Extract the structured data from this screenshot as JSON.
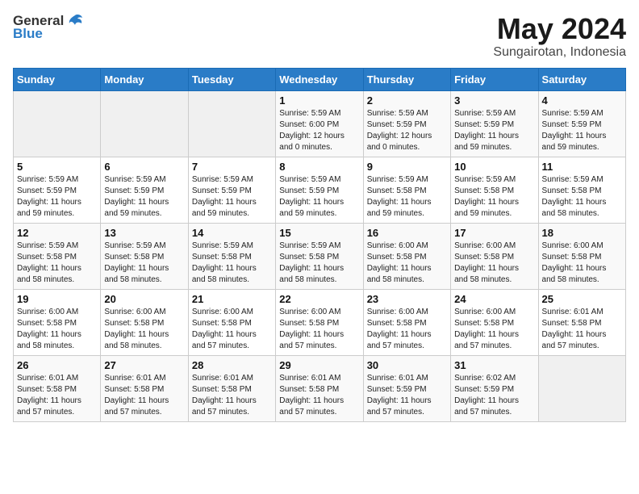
{
  "logo": {
    "general": "General",
    "blue": "Blue"
  },
  "title": "May 2024",
  "location": "Sungairotan, Indonesia",
  "days_of_week": [
    "Sunday",
    "Monday",
    "Tuesday",
    "Wednesday",
    "Thursday",
    "Friday",
    "Saturday"
  ],
  "weeks": [
    [
      {
        "day": "",
        "info": ""
      },
      {
        "day": "",
        "info": ""
      },
      {
        "day": "",
        "info": ""
      },
      {
        "day": "1",
        "info": "Sunrise: 5:59 AM\nSunset: 6:00 PM\nDaylight: 12 hours\nand 0 minutes."
      },
      {
        "day": "2",
        "info": "Sunrise: 5:59 AM\nSunset: 5:59 PM\nDaylight: 12 hours\nand 0 minutes."
      },
      {
        "day": "3",
        "info": "Sunrise: 5:59 AM\nSunset: 5:59 PM\nDaylight: 11 hours\nand 59 minutes."
      },
      {
        "day": "4",
        "info": "Sunrise: 5:59 AM\nSunset: 5:59 PM\nDaylight: 11 hours\nand 59 minutes."
      }
    ],
    [
      {
        "day": "5",
        "info": "Sunrise: 5:59 AM\nSunset: 5:59 PM\nDaylight: 11 hours\nand 59 minutes."
      },
      {
        "day": "6",
        "info": "Sunrise: 5:59 AM\nSunset: 5:59 PM\nDaylight: 11 hours\nand 59 minutes."
      },
      {
        "day": "7",
        "info": "Sunrise: 5:59 AM\nSunset: 5:59 PM\nDaylight: 11 hours\nand 59 minutes."
      },
      {
        "day": "8",
        "info": "Sunrise: 5:59 AM\nSunset: 5:59 PM\nDaylight: 11 hours\nand 59 minutes."
      },
      {
        "day": "9",
        "info": "Sunrise: 5:59 AM\nSunset: 5:58 PM\nDaylight: 11 hours\nand 59 minutes."
      },
      {
        "day": "10",
        "info": "Sunrise: 5:59 AM\nSunset: 5:58 PM\nDaylight: 11 hours\nand 59 minutes."
      },
      {
        "day": "11",
        "info": "Sunrise: 5:59 AM\nSunset: 5:58 PM\nDaylight: 11 hours\nand 58 minutes."
      }
    ],
    [
      {
        "day": "12",
        "info": "Sunrise: 5:59 AM\nSunset: 5:58 PM\nDaylight: 11 hours\nand 58 minutes."
      },
      {
        "day": "13",
        "info": "Sunrise: 5:59 AM\nSunset: 5:58 PM\nDaylight: 11 hours\nand 58 minutes."
      },
      {
        "day": "14",
        "info": "Sunrise: 5:59 AM\nSunset: 5:58 PM\nDaylight: 11 hours\nand 58 minutes."
      },
      {
        "day": "15",
        "info": "Sunrise: 5:59 AM\nSunset: 5:58 PM\nDaylight: 11 hours\nand 58 minutes."
      },
      {
        "day": "16",
        "info": "Sunrise: 6:00 AM\nSunset: 5:58 PM\nDaylight: 11 hours\nand 58 minutes."
      },
      {
        "day": "17",
        "info": "Sunrise: 6:00 AM\nSunset: 5:58 PM\nDaylight: 11 hours\nand 58 minutes."
      },
      {
        "day": "18",
        "info": "Sunrise: 6:00 AM\nSunset: 5:58 PM\nDaylight: 11 hours\nand 58 minutes."
      }
    ],
    [
      {
        "day": "19",
        "info": "Sunrise: 6:00 AM\nSunset: 5:58 PM\nDaylight: 11 hours\nand 58 minutes."
      },
      {
        "day": "20",
        "info": "Sunrise: 6:00 AM\nSunset: 5:58 PM\nDaylight: 11 hours\nand 58 minutes."
      },
      {
        "day": "21",
        "info": "Sunrise: 6:00 AM\nSunset: 5:58 PM\nDaylight: 11 hours\nand 57 minutes."
      },
      {
        "day": "22",
        "info": "Sunrise: 6:00 AM\nSunset: 5:58 PM\nDaylight: 11 hours\nand 57 minutes."
      },
      {
        "day": "23",
        "info": "Sunrise: 6:00 AM\nSunset: 5:58 PM\nDaylight: 11 hours\nand 57 minutes."
      },
      {
        "day": "24",
        "info": "Sunrise: 6:00 AM\nSunset: 5:58 PM\nDaylight: 11 hours\nand 57 minutes."
      },
      {
        "day": "25",
        "info": "Sunrise: 6:01 AM\nSunset: 5:58 PM\nDaylight: 11 hours\nand 57 minutes."
      }
    ],
    [
      {
        "day": "26",
        "info": "Sunrise: 6:01 AM\nSunset: 5:58 PM\nDaylight: 11 hours\nand 57 minutes."
      },
      {
        "day": "27",
        "info": "Sunrise: 6:01 AM\nSunset: 5:58 PM\nDaylight: 11 hours\nand 57 minutes."
      },
      {
        "day": "28",
        "info": "Sunrise: 6:01 AM\nSunset: 5:58 PM\nDaylight: 11 hours\nand 57 minutes."
      },
      {
        "day": "29",
        "info": "Sunrise: 6:01 AM\nSunset: 5:58 PM\nDaylight: 11 hours\nand 57 minutes."
      },
      {
        "day": "30",
        "info": "Sunrise: 6:01 AM\nSunset: 5:59 PM\nDaylight: 11 hours\nand 57 minutes."
      },
      {
        "day": "31",
        "info": "Sunrise: 6:02 AM\nSunset: 5:59 PM\nDaylight: 11 hours\nand 57 minutes."
      },
      {
        "day": "",
        "info": ""
      }
    ]
  ]
}
